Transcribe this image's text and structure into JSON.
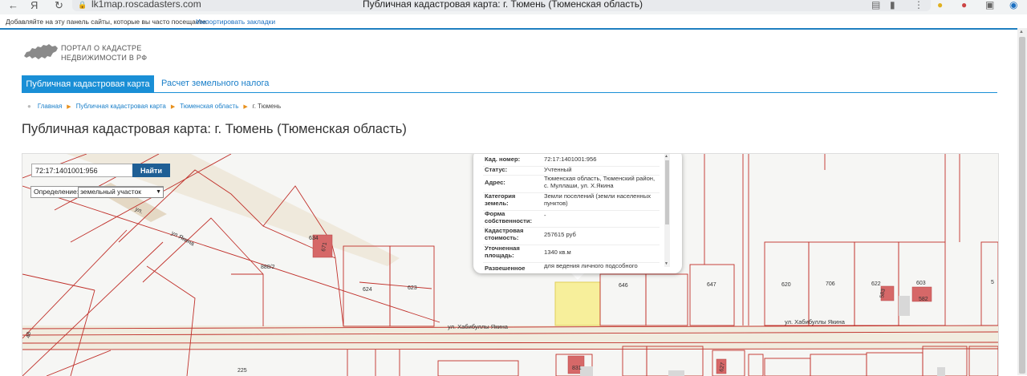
{
  "browser": {
    "url": "lk1map.roscadasters.com",
    "tab_title": "Публичная кадастровая карта: г. Тюмень (Тюменская область)",
    "back_icon": "←",
    "yandex_icon": "Я",
    "reload_icon": "↻",
    "bookmarks_prompt": "Добавляйте на эту панель сайты, которые вы часто посещаете.",
    "bookmarks_import": "Импортировать закладки"
  },
  "logo": {
    "line1": "ПОРТАЛ О КАДАСТРЕ",
    "line2": "НЕДВИЖИМОСТИ В РФ"
  },
  "tabs": [
    {
      "label": "Публичная кадастровая карта",
      "active": true
    },
    {
      "label": "Расчет земельного налога",
      "active": false
    }
  ],
  "breadcrumb": [
    "Главная",
    "Публичная кадастровая карта",
    "Тюменская область",
    "г. Тюмень"
  ],
  "page_title": "Публичная кадастровая карта: г. Тюмень (Тюменская область)",
  "map": {
    "search_value": "72:17:1401001:956",
    "search_button": "Найти",
    "definition_label": "Определение:",
    "definition_value": "земельный участок",
    "info": [
      {
        "key": "Кад. номер:",
        "value": "72:17:1401001:956"
      },
      {
        "key": "Статус:",
        "value": "Учтенный"
      },
      {
        "key": "Адрес:",
        "value": "Тюменская область, Тюменский район, с. Муллаши, ул. Х.Якина"
      },
      {
        "key": "Категория земель:",
        "value": "Земли поселений (земли населенных пунктов)"
      },
      {
        "key": "Форма собственности:",
        "value": "-"
      },
      {
        "key": "Кадастровая стоимость:",
        "value": "257615 руб"
      },
      {
        "key": "Уточненная площадь:",
        "value": "1340 кв.м"
      },
      {
        "key": "Разрешенное",
        "value": "для ведения личного подсобного"
      }
    ],
    "parcel_labels": [
      "634",
      "671",
      "888/2",
      "624",
      "623",
      "646",
      "647",
      "620",
      "706",
      "622",
      "603",
      "583",
      "582",
      "5",
      "225",
      "48",
      "831",
      "627"
    ],
    "street_labels": [
      "ул. Хабибуллы Якина",
      "ул. Хабибуллы Якина",
      "ул Якина",
      "ул."
    ],
    "colors": {
      "parcel_line": "#c0302a",
      "selected_fill": "#f7ef9b",
      "building": "#d66868"
    }
  }
}
